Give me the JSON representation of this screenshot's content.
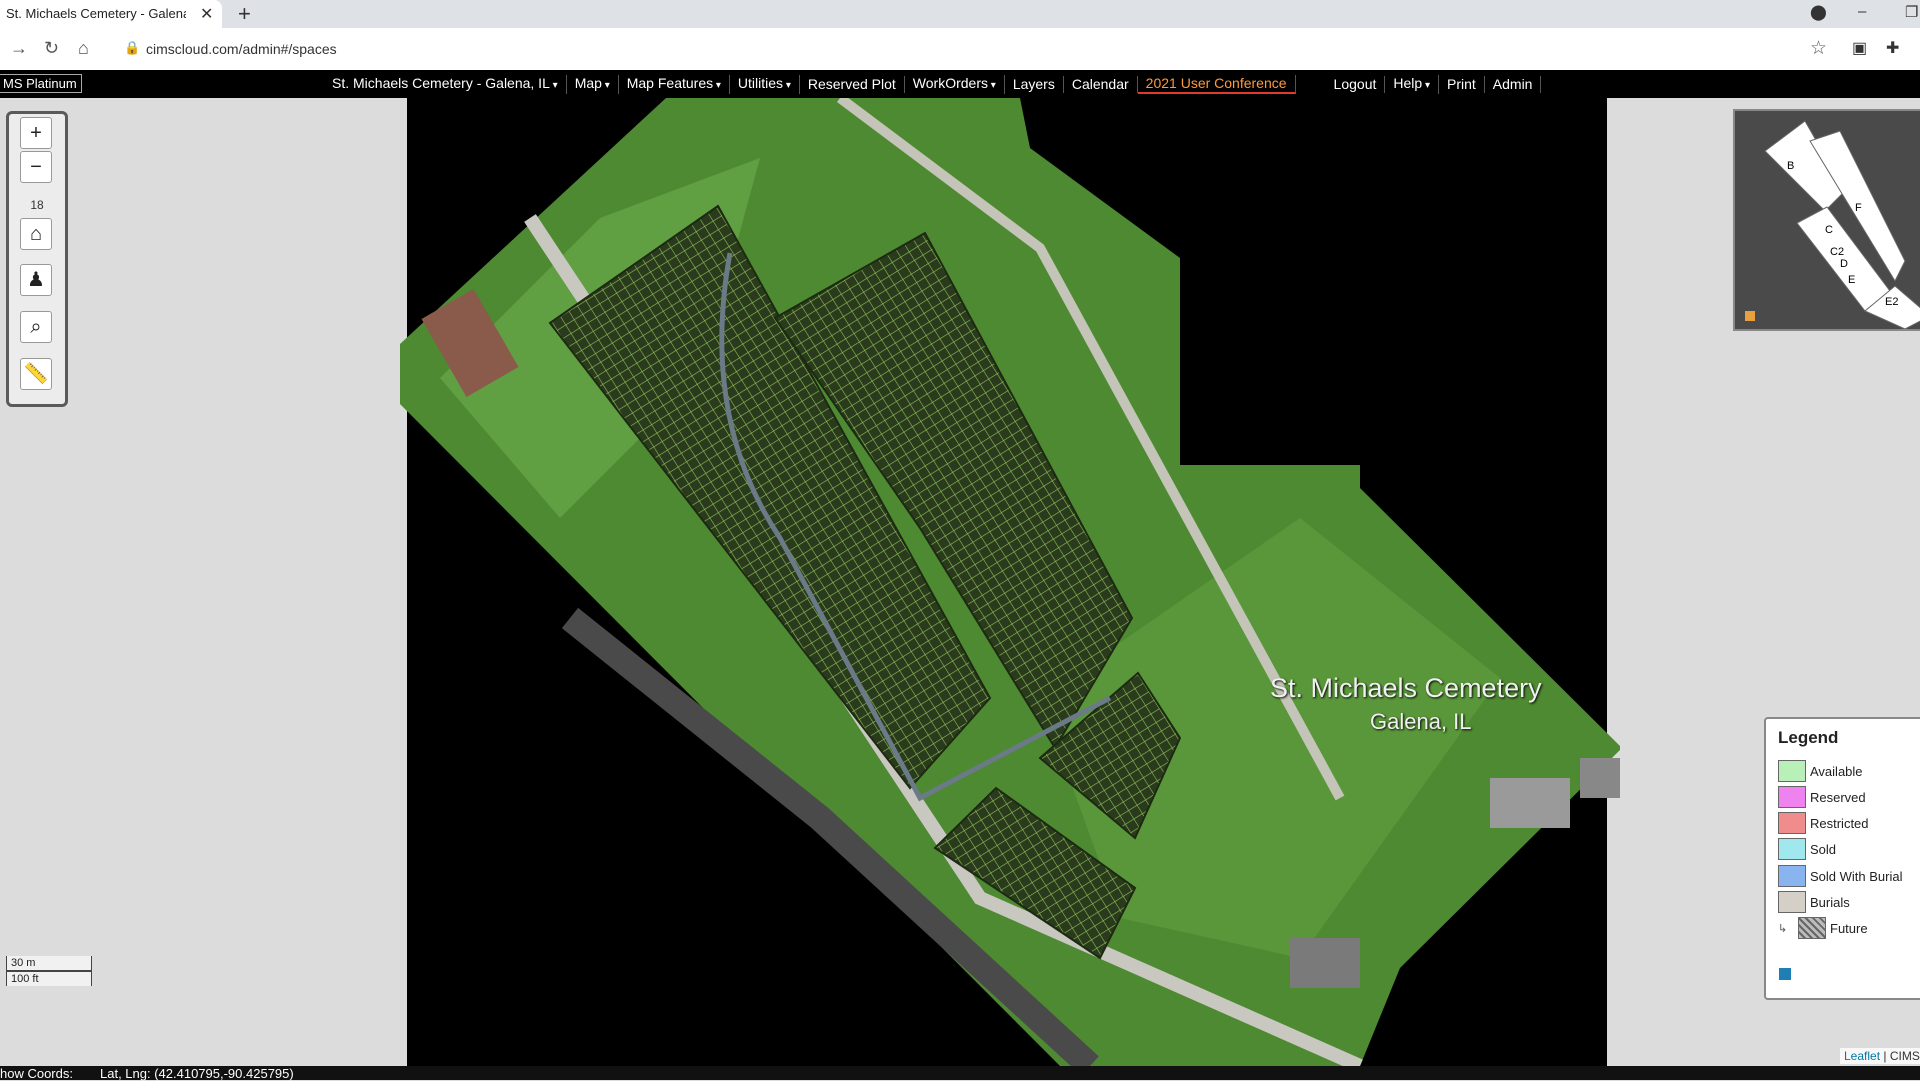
{
  "browser": {
    "tab_title": "St. Michaels Cemetery - Galena, I",
    "new_tab_icon": "plus-icon",
    "url": "cimscloud.com/admin#/spaces"
  },
  "navbar": {
    "brand": "MS Platinum",
    "cemetery_menu": "St. Michaels Cemetery - Galena, IL",
    "items": [
      "Map",
      "Map Features",
      "Utilities",
      "Reserved Plot",
      "WorkOrders",
      "Layers",
      "Calendar",
      "2021 User Conference"
    ],
    "right_items": [
      "Logout",
      "Help",
      "Print",
      "Admin"
    ],
    "highlight_color": "#ff9a3c"
  },
  "map": {
    "zoom_level": "18",
    "overlay_title": "St. Michaels Cemetery",
    "overlay_subtitle": "Galena, IL",
    "minimap_sections": [
      "B",
      "F",
      "C",
      "C2",
      "D",
      "E",
      "E2"
    ],
    "scale_metric": "30 m",
    "scale_imperial": "100 ft",
    "attribution_link": "Leaflet",
    "attribution_text": " | CIMS I"
  },
  "legend": {
    "title": "Legend",
    "items": [
      {
        "label": "Available",
        "color": "#b8f0b8"
      },
      {
        "label": "Reserved",
        "color": "#ee82ee"
      },
      {
        "label": "Restricted",
        "color": "#f08c8c"
      },
      {
        "label": "Sold",
        "color": "#a0e8ee"
      },
      {
        "label": "Sold With Burial",
        "color": "#8ab4f0"
      },
      {
        "label": "Burials",
        "color": "#d4d0c8"
      },
      {
        "label": "Future",
        "color": "pattern"
      }
    ]
  },
  "statusbar": {
    "coords_label": "how Coords:",
    "coords_value": "Lat, Lng: (42.410795,-90.425795)"
  }
}
